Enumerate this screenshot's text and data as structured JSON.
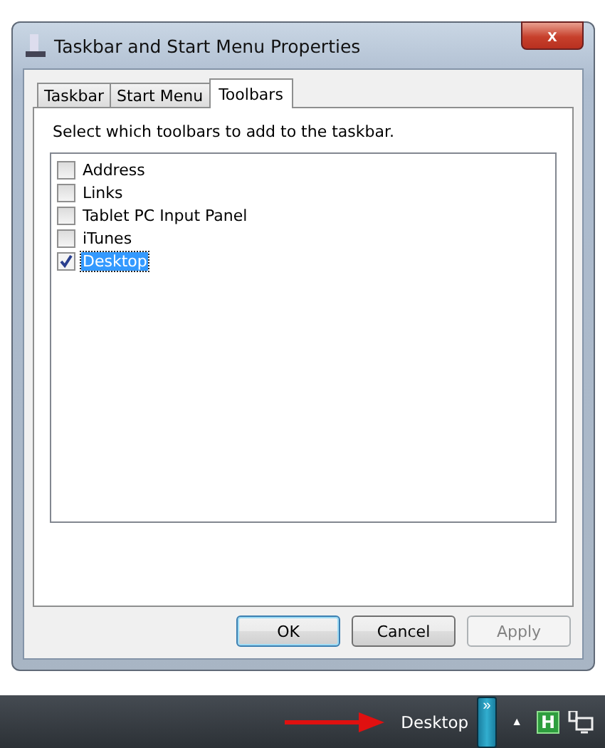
{
  "window": {
    "title": "Taskbar and Start Menu Properties",
    "close": "x"
  },
  "tabs": [
    {
      "label": "Taskbar",
      "selected": false
    },
    {
      "label": "Start Menu",
      "selected": false
    },
    {
      "label": "Toolbars",
      "selected": true
    }
  ],
  "instruction": "Select which toolbars to add to the taskbar.",
  "toolbars": [
    {
      "label": "Address",
      "checked": false,
      "selected": false
    },
    {
      "label": "Links",
      "checked": false,
      "selected": false
    },
    {
      "label": "Tablet PC Input Panel",
      "checked": false,
      "selected": false
    },
    {
      "label": "iTunes",
      "checked": false,
      "selected": false
    },
    {
      "label": "Desktop",
      "checked": true,
      "selected": true
    }
  ],
  "buttons": [
    {
      "label": "OK",
      "disabled": false
    },
    {
      "label": "Cancel",
      "disabled": false
    },
    {
      "label": "Apply",
      "disabled": true
    }
  ],
  "taskbar": {
    "toolbar_label": "Desktop",
    "chevron": "»",
    "tray_arrow": "▲",
    "app_icon_letter": "H"
  }
}
